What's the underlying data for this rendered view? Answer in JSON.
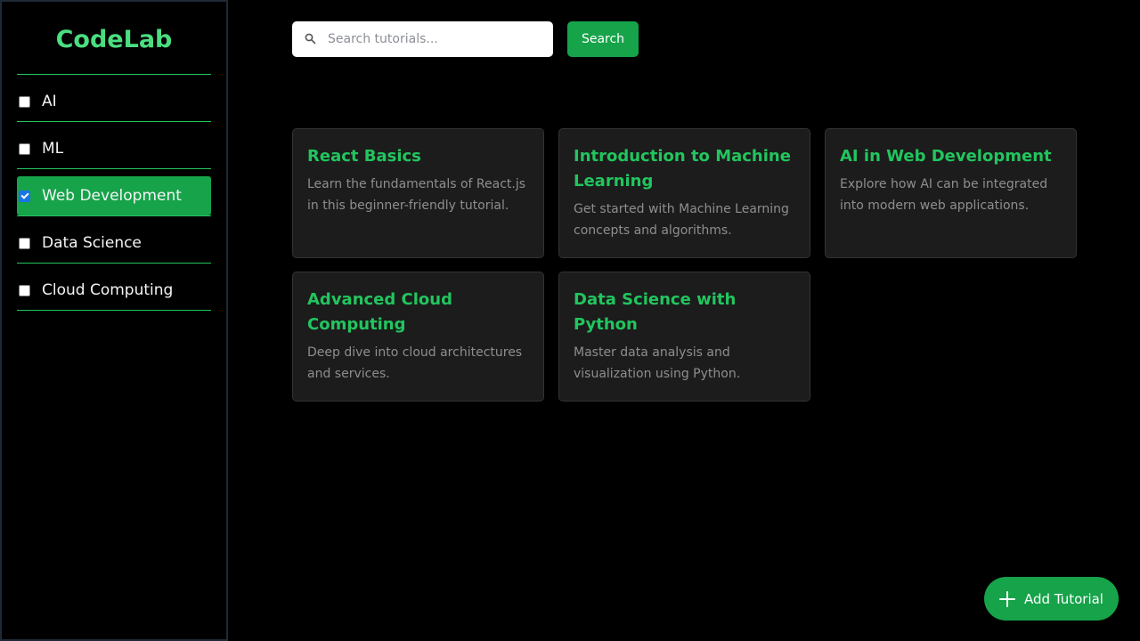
{
  "brand": {
    "name": "CodeLab"
  },
  "categories": [
    {
      "label": "AI",
      "checked": false
    },
    {
      "label": "ML",
      "checked": false
    },
    {
      "label": "Web Development",
      "checked": true
    },
    {
      "label": "Data Science",
      "checked": false
    },
    {
      "label": "Cloud Computing",
      "checked": false
    }
  ],
  "search": {
    "placeholder": "Search tutorials...",
    "value": "",
    "button_label": "Search",
    "icon": "search-icon"
  },
  "tutorials": [
    {
      "title": "React Basics",
      "description": "Learn the fundamentals of React.js in this beginner-friendly tutorial."
    },
    {
      "title": "Introduction to Machine Learning",
      "description": "Get started with Machine Learning concepts and algorithms."
    },
    {
      "title": "AI in Web Development",
      "description": "Explore how AI can be integrated into modern web applications."
    },
    {
      "title": "Advanced Cloud Computing",
      "description": "Deep dive into cloud architectures and services."
    },
    {
      "title": "Data Science with Python",
      "description": "Master data analysis and visualization using Python."
    }
  ],
  "fab": {
    "label": "Add Tutorial",
    "icon": "plus-icon"
  },
  "colors": {
    "accent": "#16a34a",
    "accent_text": "#22c55e",
    "brand_text": "#4ade80",
    "card_bg": "#1c1c1c",
    "page_bg": "#000000"
  }
}
